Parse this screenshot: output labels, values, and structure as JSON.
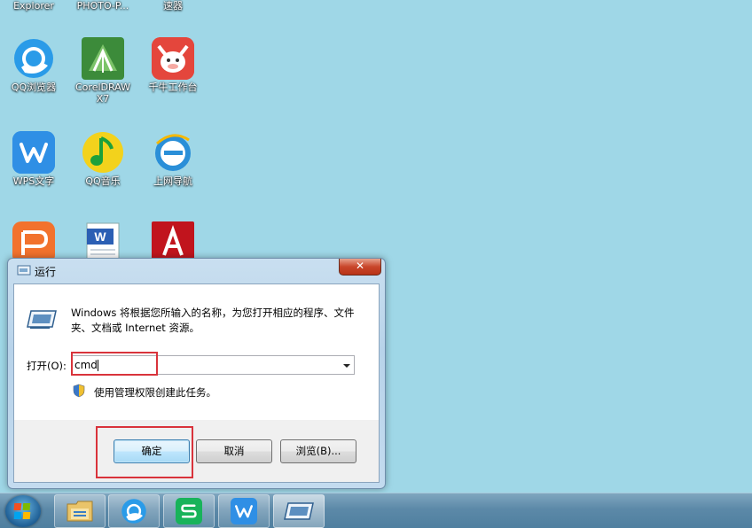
{
  "desktop": {
    "icons": [
      {
        "label": "Explorer"
      },
      {
        "label": "PHOTO-P..."
      },
      {
        "label": "速器"
      },
      {
        "label": "QQ浏览器"
      },
      {
        "label": "CorelDRAW\nX7"
      },
      {
        "label": "千牛工作台"
      },
      {
        "label": "WPS文字"
      },
      {
        "label": "QQ音乐"
      },
      {
        "label": "上网导航"
      },
      {
        "label": ""
      },
      {
        "label": ""
      },
      {
        "label": ""
      }
    ]
  },
  "run_dialog": {
    "title": "运行",
    "close_glyph": "✕",
    "description": "Windows 将根据您所输入的名称，为您打开相应的程序、文件夹、文档或 Internet 资源。",
    "open_label": "打开(O):",
    "input_value": "cmd",
    "admin_text": "使用管理权限创建此任务。",
    "ok_label": "确定",
    "cancel_label": "取消",
    "browse_label": "浏览(B)..."
  },
  "taskbar": {
    "items": [
      "file-explorer",
      "qq-browser",
      "wps-spreadsheet",
      "wps-writer",
      "run"
    ]
  },
  "colors": {
    "highlight": "#d9333b",
    "desktop": "#9fd7e7"
  }
}
